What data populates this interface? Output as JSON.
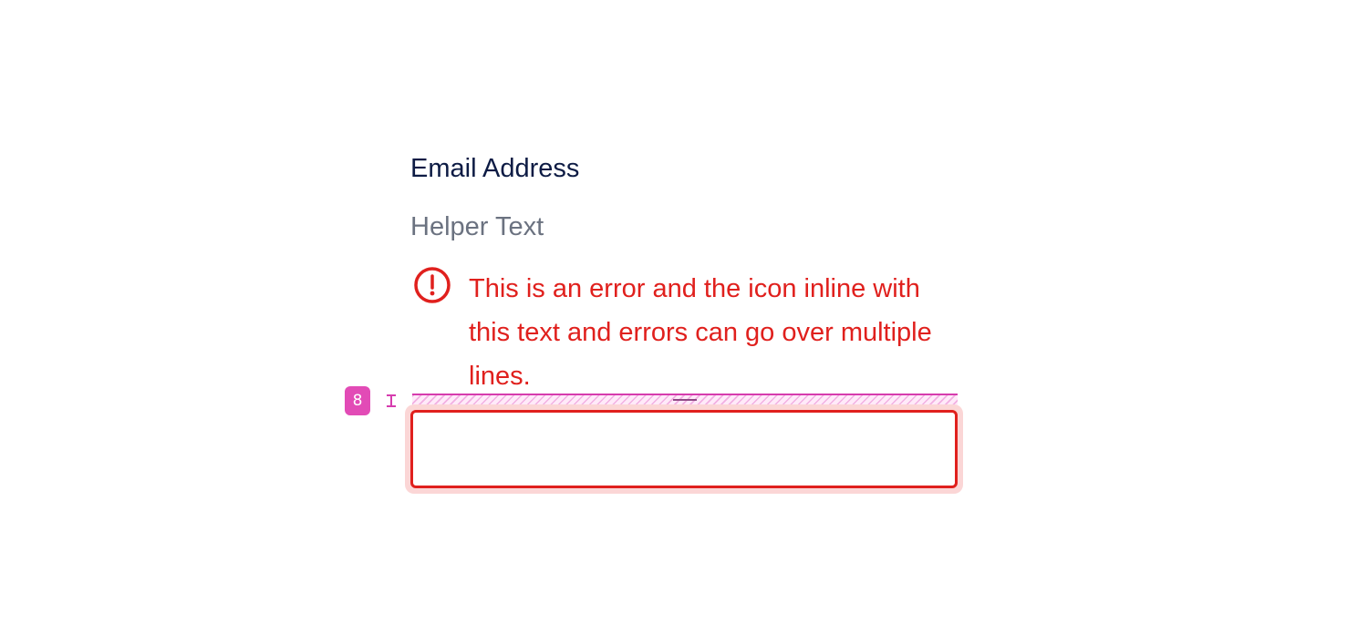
{
  "field": {
    "label": "Email Address",
    "helper_text": "Helper Text",
    "error_message": "This is an error and the icon inline with this text and errors can go over multiple lines.",
    "input_value": "",
    "input_placeholder": ""
  },
  "spacing_annotation": {
    "value": "8"
  },
  "icons": {
    "error": "exclamation-circle-icon",
    "spacing": "i-beam-icon"
  },
  "colors": {
    "label": "#0d1b44",
    "helper": "#6b7280",
    "error": "#e0201d",
    "error_halo": "#fbd6d6",
    "annotation": "#e24bb6"
  }
}
